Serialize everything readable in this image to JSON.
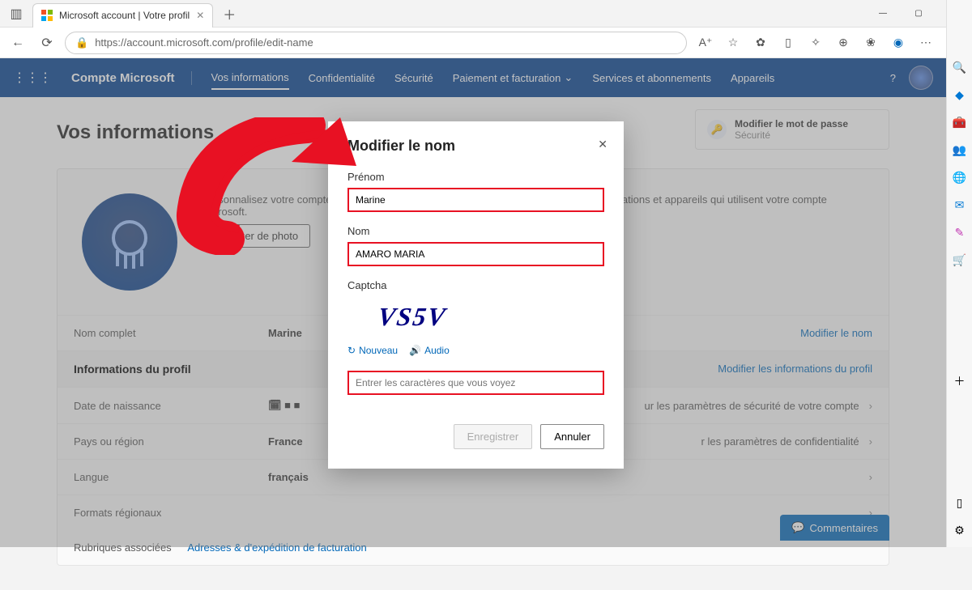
{
  "titlebar": {
    "tab_title": "Microsoft account | Votre profil"
  },
  "addressbar": {
    "url": "https://account.microsoft.com/profile/edit-name"
  },
  "colors": {
    "accent": "#003e8f",
    "link": "#0067b8",
    "highlight": "#e81123"
  },
  "msnav": {
    "brand": "Compte Microsoft",
    "items": [
      "Vos informations",
      "Confidentialité",
      "Sécurité",
      "Paiement et facturation",
      "Services et abonnements",
      "Appareils"
    ]
  },
  "page": {
    "title": "Vos informations",
    "quick": {
      "title": "Modifier le mot de passe",
      "sub": "Sécurité"
    },
    "profile_text": "Personnalisez votre compte avec une photo. Votre photo de profil apparaîtra sur les applications et appareils qui utilisent votre compte Microsoft.",
    "change_photo": "Changer de photo",
    "rows": {
      "fullname_label": "Nom complet",
      "fullname_value": "Marine",
      "fullname_link": "Modifier le nom",
      "profile_info_header": "Informations du profil",
      "profile_info_link": "Modifier les informations du profil",
      "dob_label": "Date de naissance",
      "dob_value": "",
      "dob_extra": "ur les paramètres de sécurité de votre compte",
      "country_label": "Pays ou région",
      "country_value": "France",
      "country_extra": "r les paramètres de confidentialité",
      "lang_label": "Langue",
      "lang_value": "français",
      "regional_label": "Formats régionaux"
    },
    "rubriques_label": "Rubriques associées",
    "rubriques_link": "Adresses & d'expédition de facturation"
  },
  "modal": {
    "title": "Modifier le nom",
    "firstname_label": "Prénom",
    "firstname_value": "Marine",
    "lastname_label": "Nom",
    "lastname_value": "AMARO MARIA",
    "captcha_label": "Captcha",
    "captcha_text": "VS5V",
    "new_label": "Nouveau",
    "audio_label": "Audio",
    "captcha_placeholder": "Entrer les caractères que vous voyez",
    "save": "Enregistrer",
    "cancel": "Annuler"
  },
  "feedback": "Commentaires"
}
